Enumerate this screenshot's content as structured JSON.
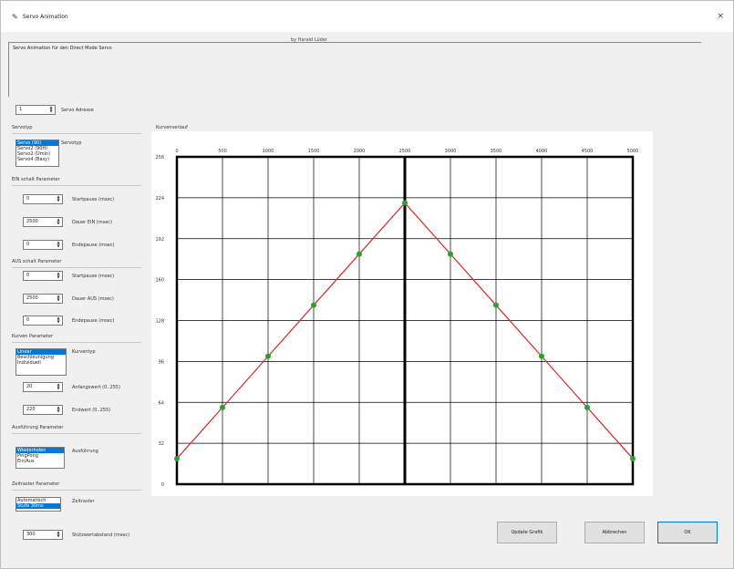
{
  "window": {
    "title": "Servo Animation",
    "title_icon": "feather-icon",
    "close_label": "×",
    "author": "by Harald Lüder",
    "description": "Servo Animation für den Direct Mode Servo"
  },
  "address": {
    "value": "1",
    "label": "Servo Adresse"
  },
  "servotyp": {
    "group": "Servotyp",
    "label": "Servotyp",
    "items": [
      "Servo (90)",
      "Servo2 (90H)",
      "Servo2 (Umin)",
      "Servo4 (Basy)"
    ],
    "selected_index": 0
  },
  "ein": {
    "group": "EIN schalt Parameter",
    "fields": [
      {
        "value": "0",
        "label": "Startpause (msec)"
      },
      {
        "value": "2500",
        "label": "Dauer EIN (msec)"
      },
      {
        "value": "0",
        "label": "Endepause (msec)"
      }
    ]
  },
  "aus": {
    "group": "AUS schalt Parameter",
    "fields": [
      {
        "value": "0",
        "label": "Startpause (msec)"
      },
      {
        "value": "2500",
        "label": "Dauer AUS (msec)"
      },
      {
        "value": "0",
        "label": "Endepause (msec)"
      }
    ]
  },
  "kurven": {
    "group": "Kurven Parameter",
    "label": "Kurventyp",
    "items": [
      "Linear",
      "Beschleunigung",
      "Individuell"
    ],
    "selected_index": 0,
    "fields": [
      {
        "value": "20",
        "label": "Anfangswert (0..255)"
      },
      {
        "value": "220",
        "label": "Endwert (0..255)"
      }
    ]
  },
  "ausfuehrung": {
    "group": "Ausführung Parameter",
    "label": "Ausführung",
    "items": [
      "Wiederholen",
      "PingPong",
      "Ein/Aus"
    ],
    "selected_index": 0
  },
  "zeitraster": {
    "group": "Zeitraster Parameter",
    "label": "Zeitraster",
    "items": [
      "Automatisch",
      "Stufe 30ms"
    ],
    "selected_index": 1,
    "field": {
      "value": "300",
      "label": "Stützwertabstand (msec)"
    }
  },
  "buttons": {
    "update": "Update Grafik",
    "cancel": "Abbrechen",
    "ok": "OK"
  },
  "colors": {
    "curve": "#d62728",
    "point": "#2ca02c",
    "selection": "#0078d7"
  },
  "chart_data": {
    "type": "line",
    "title": "Kurvenverlauf",
    "x_ticks": [
      "0",
      "500",
      "1000",
      "1500",
      "2000",
      "2500",
      "3000",
      "3500",
      "4000",
      "4500",
      "5000"
    ],
    "y_ticks": [
      "256",
      "224",
      "192",
      "160",
      "128",
      "96",
      "64",
      "32",
      "0"
    ],
    "xlim": [
      0,
      5000
    ],
    "ylim": [
      0,
      256
    ],
    "grid": true,
    "marker_x": 2500,
    "series": [
      {
        "x": [
          0,
          500,
          1000,
          1500,
          2000,
          2500,
          3000,
          3500,
          4000,
          4500,
          5000
        ],
        "y": [
          20,
          60,
          100,
          140,
          180,
          220,
          180,
          140,
          100,
          60,
          20
        ]
      }
    ]
  }
}
